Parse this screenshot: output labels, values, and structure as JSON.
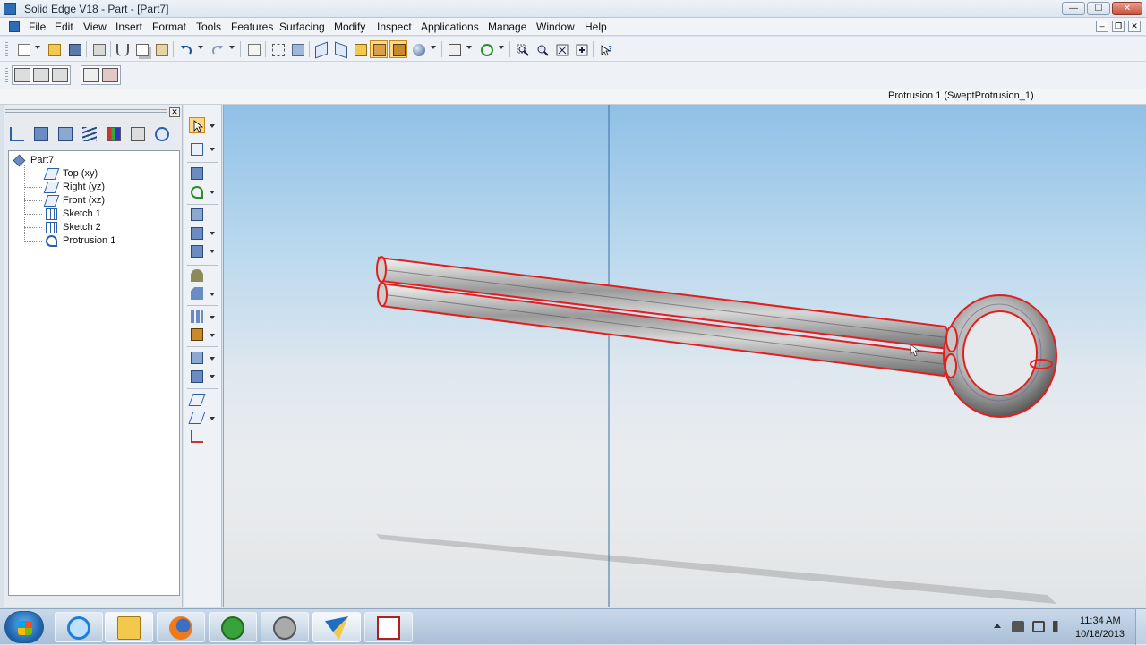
{
  "window": {
    "title": "Solid Edge V18 - Part - [Part7]",
    "minimize": "—",
    "maximize": "☐",
    "close": "✕"
  },
  "menu": {
    "items": [
      "File",
      "Edit",
      "View",
      "Insert",
      "Format",
      "Tools",
      "Features",
      "Surfacing",
      "Modify",
      "Inspect",
      "Applications",
      "Manage",
      "Window",
      "Help"
    ],
    "doc_minimize": "–",
    "doc_restore": "❐",
    "doc_close": "✕"
  },
  "status": {
    "selection_text": "Protrusion 1 (SweptProtrusion_1)"
  },
  "pathfinder": {
    "close_label": "✕",
    "tree": [
      {
        "label": "Part7",
        "icon": "part-icon"
      },
      {
        "label": "Top (xy)",
        "icon": "plane-icon"
      },
      {
        "label": "Right (yz)",
        "icon": "plane-icon"
      },
      {
        "label": "Front (xz)",
        "icon": "plane-icon"
      },
      {
        "label": "Sketch 1",
        "icon": "sketch-icon"
      },
      {
        "label": "Sketch 2",
        "icon": "sketch-icon"
      },
      {
        "label": "Protrusion 1",
        "icon": "protrusion-icon"
      }
    ]
  },
  "colors": {
    "selection_edge": "#e02020",
    "viewport_sky": "#8fc0e6",
    "model_metal": "#9a9a9a"
  },
  "taskbar": {
    "apps": [
      "internet-explorer-icon",
      "file-explorer-icon",
      "firefox-icon",
      "utorrent-icon",
      "media-player-icon",
      "solid-edge-icon",
      "paint-icon"
    ],
    "time": "11:34 AM",
    "date": "10/18/2013"
  }
}
